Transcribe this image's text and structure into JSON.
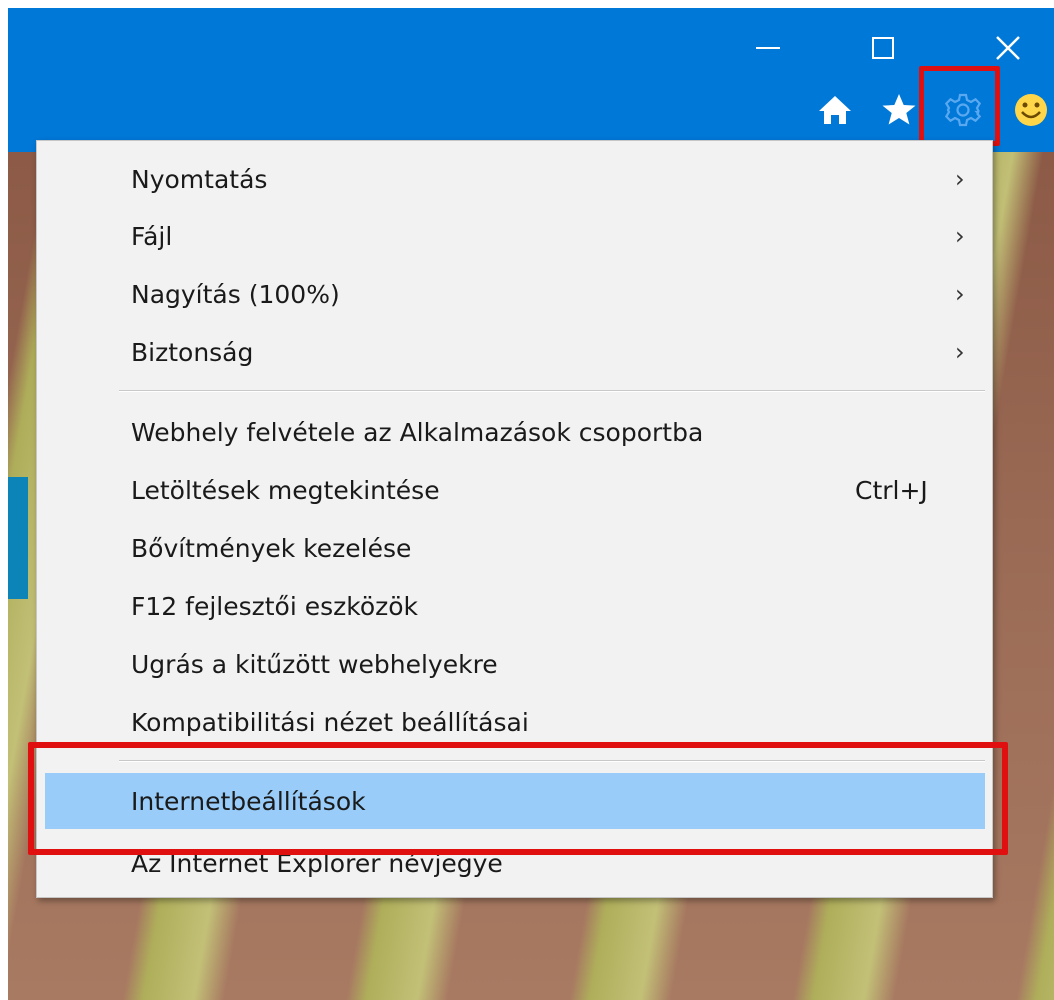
{
  "window": {
    "controls": [
      "minimize-icon",
      "maximize-icon",
      "close-icon"
    ]
  },
  "toolbar": {
    "icons": [
      "home-icon",
      "star-icon",
      "gear-icon",
      "smiley-icon"
    ],
    "gear_color": "#5aa8f0"
  },
  "menu": {
    "items": [
      {
        "label": "Nyomtatás",
        "submenu": true
      },
      {
        "label": "Fájl",
        "submenu": true
      },
      {
        "label": "Nagyítás (100%)",
        "submenu": true
      },
      {
        "label": "Biztonság",
        "submenu": true
      },
      {
        "label": "Webhely felvétele az Alkalmazások csoportba"
      },
      {
        "label": "Letöltések megtekintése",
        "shortcut": "Ctrl+J"
      },
      {
        "label": "Bővítmények kezelése"
      },
      {
        "label": "F12 fejlesztői eszközök"
      },
      {
        "label": "Ugrás a kitűzött webhelyekre"
      },
      {
        "label": "Kompatibilitási nézet beállításai"
      },
      {
        "label": "Internetbeállítások",
        "highlighted": true
      },
      {
        "label": "Az Internet Explorer névjegye"
      }
    ],
    "arrow": "›",
    "highlight_color": "#99ccf8",
    "annotation_color": "#e01010"
  }
}
